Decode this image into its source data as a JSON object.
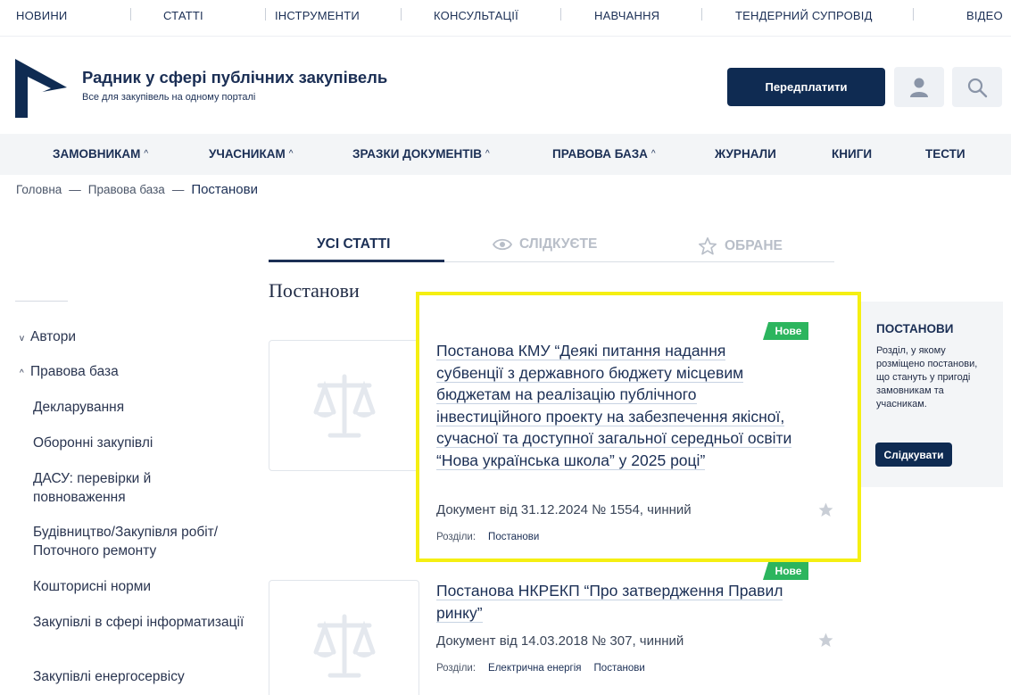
{
  "top_nav": [
    "НОВИНИ",
    "СТАТТІ",
    "ІНСТРУМЕНТИ",
    "КОНСУЛЬТАЦІЇ",
    "НАВЧАННЯ",
    "ТЕНДЕРНИЙ СУПРОВІД",
    "ВІДЕО"
  ],
  "brand": {
    "title": "Радник у сфері публічних закупівель",
    "subtitle": "Все для закупівель на одному порталі"
  },
  "header": {
    "subscribe_label": "Передплатити",
    "user_icon": "user-icon",
    "search_icon": "search-icon"
  },
  "main_nav": [
    "ЗАМОВНИКАМ",
    "УЧАСНИКАМ",
    "ЗРАЗКИ ДОКУМЕНТІВ",
    "ПРАВОВА БАЗА",
    "ЖУРНАЛИ",
    "КНИГИ",
    "ТЕСТИ"
  ],
  "breadcrumb": {
    "items": [
      "Головна",
      "Правова база",
      "Постанови"
    ],
    "separator": "—"
  },
  "tabs": [
    "УСІ СТАТТІ",
    "СЛІДКУЄТЕ",
    "ОБРАНЕ"
  ],
  "page_heading": "Постанови",
  "sidebar": {
    "top": [
      "Автори",
      "Правова база"
    ],
    "sub": [
      "Декларування",
      "Оборонні закупівлі",
      "ДАСУ: перевірки й повноваження",
      "Будівництво/Закупівля робіт/ Поточного ремонту",
      "Кошторисні норми",
      "Закупівлі в сфері інформатизації",
      "Закупівлі енергосервісу"
    ]
  },
  "cards": [
    {
      "badge": "Нове",
      "title": "Постанова КМУ “Деякі питання надання субвенції з державного бюджету місцевим бюджетам на реалізацію публічного інвестиційного проекту на забезпечення якісної, сучасної та доступної загальної середньої освіти “Нова українська школа” у 2025 році”",
      "meta": "Документ від 31.12.2024 № 1554, чинний",
      "sections_label": "Розділи:",
      "sections": [
        "Постанови"
      ]
    },
    {
      "badge": "Нове",
      "title": "Постанова НКРЕКП “Про затвердження Правил ринку”",
      "meta": "Документ від 14.03.2018 № 307, чинний",
      "sections_label": "Розділи:",
      "sections": [
        "Електрична енергія",
        "Постанови"
      ]
    }
  ],
  "right_box": {
    "title": "ПОСТАНОВИ",
    "text": "Розділ, у якому розміщено постанови, що стануть у пригоді замовникам та учасникам.",
    "button": "Слідкувати"
  },
  "colors": {
    "navy": "#0f2b52",
    "badge_green": "#2cb55e",
    "highlight_yellow": "#f5ef12",
    "nav_bg": "#f3f5f7"
  }
}
